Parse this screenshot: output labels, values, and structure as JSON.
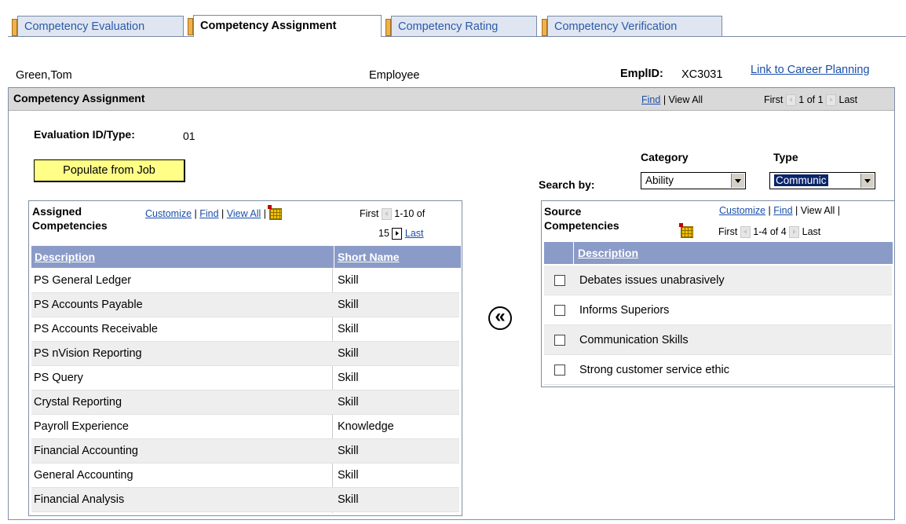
{
  "tabs": [
    {
      "label": "Competency Evaluation",
      "active": false
    },
    {
      "label": "Competency Assignment",
      "active": true
    },
    {
      "label": "Competency Rating",
      "active": false
    },
    {
      "label": "Competency Verification",
      "active": false
    }
  ],
  "header": {
    "name": "Green,Tom",
    "role": "Employee",
    "emplid_label": "EmplID:",
    "emplid_value": "XC3031",
    "career_link": "Link to Career Planning"
  },
  "main": {
    "title": "Competency Assignment",
    "find": "Find",
    "view_all": "View All",
    "first": "First",
    "count": "1 of 1",
    "last": "Last",
    "eval_label": "Evaluation ID/Type:",
    "eval_value": "01",
    "populate_button": "Populate from Job"
  },
  "search": {
    "search_by": "Search by:",
    "category_label": "Category",
    "category_value": "Ability",
    "type_label": "Type",
    "type_value": "Communic"
  },
  "assigned": {
    "title_line1": "Assigned",
    "title_line2": "Competencies",
    "customize": "Customize",
    "find": "Find",
    "view_all": "View All",
    "first": "First",
    "range": "1-10 of",
    "total": "15",
    "last": "Last",
    "col_description": "Description",
    "col_short": "Short Name",
    "rows": [
      {
        "description": "PS General Ledger",
        "short": "Skill"
      },
      {
        "description": "PS Accounts Payable",
        "short": "Skill"
      },
      {
        "description": "PS Accounts Receivable",
        "short": "Skill"
      },
      {
        "description": "PS nVision Reporting",
        "short": "Skill"
      },
      {
        "description": "PS Query",
        "short": "Skill"
      },
      {
        "description": "Crystal Reporting",
        "short": "Skill"
      },
      {
        "description": "Payroll Experience",
        "short": "Knowledge"
      },
      {
        "description": "Financial Accounting",
        "short": "Skill"
      },
      {
        "description": "General Accounting",
        "short": "Skill"
      },
      {
        "description": "Financial Analysis",
        "short": "Skill"
      }
    ]
  },
  "move_icon": "«",
  "source": {
    "title_line1": "Source",
    "title_line2": "Competencies",
    "customize": "Customize",
    "find": "Find",
    "view_all": "View All",
    "first": "First",
    "range": "1-4 of 4",
    "last": "Last",
    "col_description": "Description",
    "rows": [
      {
        "description": "Debates issues unabrasively"
      },
      {
        "description": "Informs Superiors"
      },
      {
        "description": "Communication Skills"
      },
      {
        "description": "Strong customer service ethic"
      }
    ]
  }
}
